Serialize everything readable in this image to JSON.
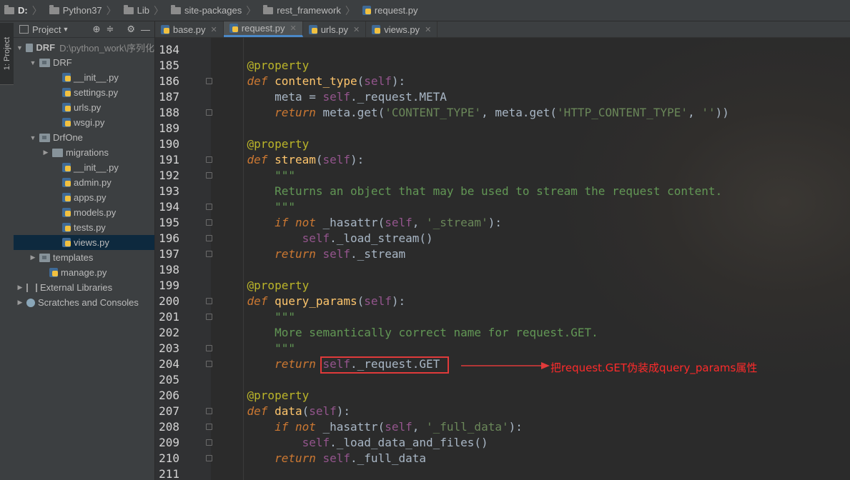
{
  "breadcrumb": [
    {
      "label": "D:",
      "bold": true
    },
    {
      "label": "Python37"
    },
    {
      "label": "Lib"
    },
    {
      "label": "site-packages"
    },
    {
      "label": "rest_framework"
    },
    {
      "label": "request.py",
      "file": true
    }
  ],
  "toolstrip": {
    "project_tab": "1: Project"
  },
  "project_panel": {
    "header_label": "Project",
    "tree": [
      {
        "label": "DRF",
        "detail": "D:\\python_work\\序列化",
        "depth": 0,
        "arrow": "down",
        "icon": "folder",
        "bold": true
      },
      {
        "label": "DRF",
        "depth": 1,
        "arrow": "down",
        "icon": "folder"
      },
      {
        "label": "__init__.py",
        "depth": 2,
        "icon": "py"
      },
      {
        "label": "settings.py",
        "depth": 2,
        "icon": "py"
      },
      {
        "label": "urls.py",
        "depth": 2,
        "icon": "py"
      },
      {
        "label": "wsgi.py",
        "depth": 2,
        "icon": "py"
      },
      {
        "label": "DrfOne",
        "depth": 1,
        "arrow": "down",
        "icon": "folder"
      },
      {
        "label": "migrations",
        "depth": 2,
        "arrow": "right",
        "icon": "folder"
      },
      {
        "label": "__init__.py",
        "depth": 2,
        "icon": "py"
      },
      {
        "label": "admin.py",
        "depth": 2,
        "icon": "py"
      },
      {
        "label": "apps.py",
        "depth": 2,
        "icon": "py"
      },
      {
        "label": "models.py",
        "depth": 2,
        "icon": "py"
      },
      {
        "label": "tests.py",
        "depth": 2,
        "icon": "py"
      },
      {
        "label": "views.py",
        "depth": 2,
        "icon": "py",
        "selected": true
      },
      {
        "label": "templates",
        "depth": 1,
        "arrow": "right",
        "icon": "folder"
      },
      {
        "label": "manage.py",
        "depth": 1,
        "icon": "py"
      },
      {
        "label": "External Libraries",
        "depth": 0,
        "arrow": "right",
        "icon": "lib"
      },
      {
        "label": "Scratches and Consoles",
        "depth": 0,
        "arrow": "right",
        "icon": "scratch"
      }
    ]
  },
  "tabs": [
    {
      "label": "base.py",
      "active": false
    },
    {
      "label": "request.py",
      "active": true
    },
    {
      "label": "urls.py",
      "active": false
    },
    {
      "label": "views.py",
      "active": false
    }
  ],
  "code": {
    "lines": [
      {
        "n": "184",
        "fold": false,
        "tokens": []
      },
      {
        "n": "185",
        "fold": false,
        "tokens": [
          [
            "dec",
            "    @property"
          ]
        ]
      },
      {
        "n": "186",
        "fold": true,
        "tokens": [
          [
            "kw",
            "    def "
          ],
          [
            "fn",
            "content_type"
          ],
          [
            "pl",
            "("
          ],
          [
            "self",
            "self"
          ],
          [
            "pl",
            "):"
          ]
        ]
      },
      {
        "n": "187",
        "fold": false,
        "tokens": [
          [
            "pl",
            "        meta = "
          ],
          [
            "self",
            "self"
          ],
          [
            "pl",
            "._request.META"
          ]
        ]
      },
      {
        "n": "188",
        "fold": true,
        "tokens": [
          [
            "kw",
            "        return "
          ],
          [
            "pl",
            "meta.get("
          ],
          [
            "str",
            "'CONTENT_TYPE'"
          ],
          [
            "pl",
            ", meta.get("
          ],
          [
            "str",
            "'HTTP_CONTENT_TYPE'"
          ],
          [
            "pl",
            ", "
          ],
          [
            "str",
            "''"
          ],
          [
            "pl",
            "))"
          ]
        ]
      },
      {
        "n": "189",
        "fold": false,
        "tokens": []
      },
      {
        "n": "190",
        "fold": false,
        "tokens": [
          [
            "dec",
            "    @property"
          ]
        ]
      },
      {
        "n": "191",
        "fold": true,
        "tokens": [
          [
            "kw",
            "    def "
          ],
          [
            "fn",
            "stream"
          ],
          [
            "pl",
            "("
          ],
          [
            "self",
            "self"
          ],
          [
            "pl",
            "):"
          ]
        ]
      },
      {
        "n": "192",
        "fold": true,
        "tokens": [
          [
            "doc",
            "        \"\"\""
          ]
        ]
      },
      {
        "n": "193",
        "fold": false,
        "tokens": [
          [
            "doc",
            "        Returns an object that may be used to stream the request content."
          ]
        ]
      },
      {
        "n": "194",
        "fold": true,
        "tokens": [
          [
            "doc",
            "        \"\"\""
          ]
        ]
      },
      {
        "n": "195",
        "fold": true,
        "tokens": [
          [
            "kw",
            "        if not "
          ],
          [
            "pl",
            "_hasattr("
          ],
          [
            "self",
            "self"
          ],
          [
            "pl",
            ", "
          ],
          [
            "str",
            "'_stream'"
          ],
          [
            "pl",
            "):"
          ]
        ]
      },
      {
        "n": "196",
        "fold": true,
        "tokens": [
          [
            "pl",
            "            "
          ],
          [
            "self",
            "self"
          ],
          [
            "pl",
            "._load_stream()"
          ]
        ]
      },
      {
        "n": "197",
        "fold": true,
        "tokens": [
          [
            "kw",
            "        return "
          ],
          [
            "self",
            "self"
          ],
          [
            "pl",
            "._stream"
          ]
        ]
      },
      {
        "n": "198",
        "fold": false,
        "tokens": []
      },
      {
        "n": "199",
        "fold": false,
        "tokens": [
          [
            "dec",
            "    @property"
          ]
        ]
      },
      {
        "n": "200",
        "fold": true,
        "tokens": [
          [
            "kw",
            "    def "
          ],
          [
            "fn",
            "query_params"
          ],
          [
            "pl",
            "("
          ],
          [
            "self",
            "self"
          ],
          [
            "pl",
            "):"
          ]
        ]
      },
      {
        "n": "201",
        "fold": true,
        "tokens": [
          [
            "doc",
            "        \"\"\""
          ]
        ]
      },
      {
        "n": "202",
        "fold": false,
        "tokens": [
          [
            "doc",
            "        More semantically correct name for request.GET."
          ]
        ]
      },
      {
        "n": "203",
        "fold": true,
        "tokens": [
          [
            "doc",
            "        \"\"\""
          ]
        ]
      },
      {
        "n": "204",
        "fold": true,
        "tokens": [
          [
            "kw",
            "        return "
          ],
          [
            "self",
            "self"
          ],
          [
            "pl",
            "._request.GET"
          ]
        ]
      },
      {
        "n": "205",
        "fold": false,
        "tokens": []
      },
      {
        "n": "206",
        "fold": false,
        "tokens": [
          [
            "dec",
            "    @property"
          ]
        ]
      },
      {
        "n": "207",
        "fold": true,
        "tokens": [
          [
            "kw",
            "    def "
          ],
          [
            "fn",
            "data"
          ],
          [
            "pl",
            "("
          ],
          [
            "self",
            "self"
          ],
          [
            "pl",
            "):"
          ]
        ]
      },
      {
        "n": "208",
        "fold": true,
        "tokens": [
          [
            "kw",
            "        if not "
          ],
          [
            "pl",
            "_hasattr("
          ],
          [
            "self",
            "self"
          ],
          [
            "pl",
            ", "
          ],
          [
            "str",
            "'_full_data'"
          ],
          [
            "pl",
            "):"
          ]
        ]
      },
      {
        "n": "209",
        "fold": true,
        "tokens": [
          [
            "pl",
            "            "
          ],
          [
            "self",
            "self"
          ],
          [
            "pl",
            "._load_data_and_files()"
          ]
        ]
      },
      {
        "n": "210",
        "fold": true,
        "tokens": [
          [
            "kw",
            "        return "
          ],
          [
            "self",
            "self"
          ],
          [
            "pl",
            "._full_data"
          ]
        ]
      },
      {
        "n": "211",
        "fold": false,
        "tokens": []
      }
    ]
  },
  "annotation": {
    "text": "把request.GET伪装成query_params属性",
    "color": "#ff2b2b"
  },
  "colors": {
    "accent": "#4a88c7",
    "highlight_box": "#e03a3a"
  },
  "icons": {
    "project": "project-icon",
    "locate": "crosshair-icon",
    "collapse": "collapse-all-icon",
    "settings": "gear-icon",
    "hide": "minimize-icon"
  }
}
